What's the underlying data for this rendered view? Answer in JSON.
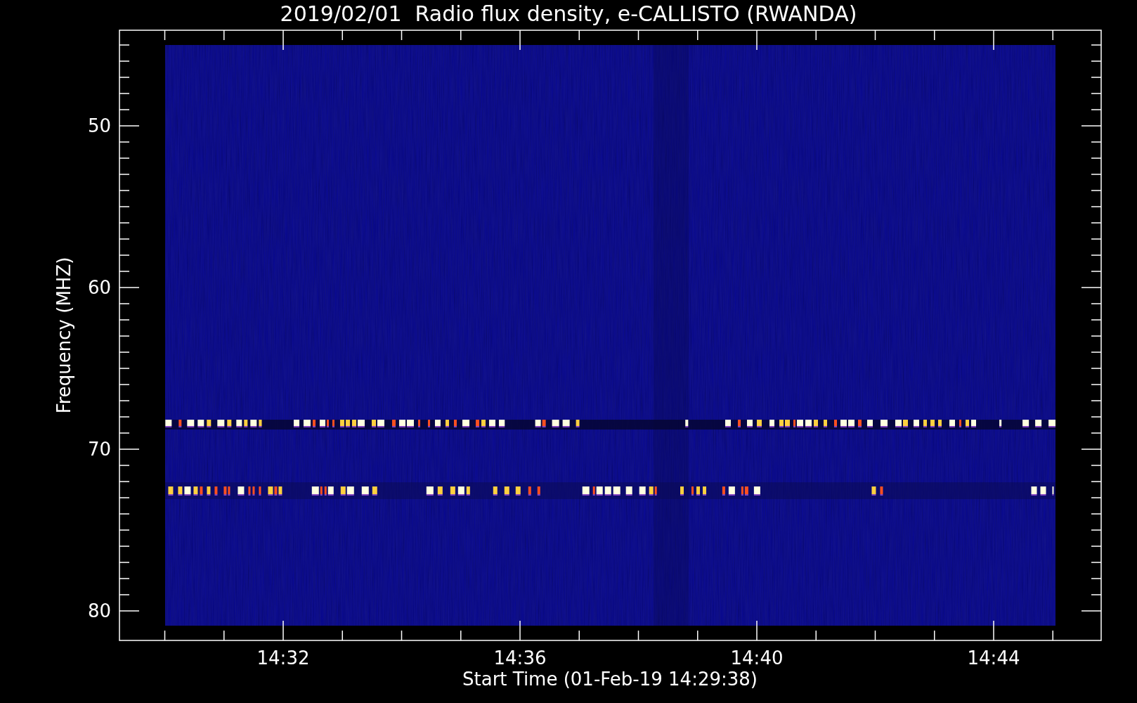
{
  "title": "2019/02/01  Radio flux density, e-CALLISTO (RWANDA)",
  "ylabel": "Frequency (MHZ)",
  "xlabel": "Start Time (01-Feb-19 14:29:38)",
  "yticks": [
    "50",
    "60",
    "70",
    "80"
  ],
  "xticks": [
    "14:32",
    "14:36",
    "14:40",
    "14:44"
  ]
}
